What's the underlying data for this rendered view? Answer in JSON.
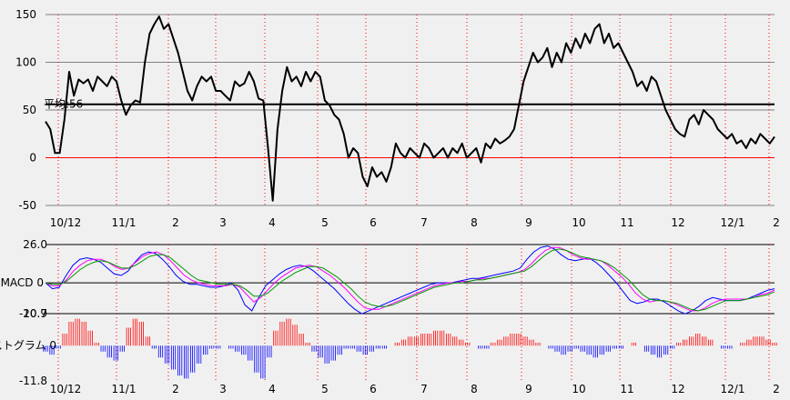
{
  "chart_data": [
    {
      "type": "line",
      "title": "",
      "x_tick_labels": [
        "10/12",
        "11/1",
        "2",
        "3",
        "4",
        "5",
        "6",
        "7",
        "8",
        "9",
        "10",
        "11",
        "12",
        "12/1",
        "2"
      ],
      "y_ticks": [
        "150",
        "100",
        "50",
        "0",
        "-50"
      ],
      "ylim": [
        -50,
        150
      ],
      "reference_lines": [
        {
          "label": "平均:56",
          "value": 56,
          "color": "#000000"
        },
        {
          "label": "",
          "value": 0,
          "color": "#ff0000"
        }
      ],
      "series": [
        {
          "values": [
            38,
            30,
            5,
            5,
            40,
            90,
            65,
            82,
            78,
            82,
            70,
            85,
            80,
            75,
            85,
            80,
            60,
            45,
            55,
            60,
            58,
            100,
            130,
            140,
            148,
            135,
            140,
            125,
            110,
            90,
            70,
            60,
            75,
            85,
            80,
            85,
            70,
            70,
            65,
            60,
            80,
            75,
            78,
            90,
            80,
            62,
            60,
            10,
            -45,
            30,
            70,
            95,
            80,
            85,
            75,
            90,
            80,
            90,
            85,
            60,
            55,
            45,
            40,
            25,
            0,
            10,
            5,
            -20,
            -30,
            -10,
            -20,
            -15,
            -25,
            -10,
            15,
            5,
            0,
            10,
            5,
            0,
            15,
            10,
            0,
            5,
            10,
            0,
            10,
            5,
            15,
            0,
            5,
            10,
            -5,
            15,
            10,
            20,
            15,
            18,
            22,
            30,
            55,
            80,
            95,
            110,
            100,
            105,
            115,
            95,
            110,
            100,
            120,
            110,
            125,
            115,
            130,
            120,
            135,
            140,
            120,
            130,
            115,
            120,
            110,
            100,
            90,
            75,
            80,
            70,
            85,
            80,
            65,
            50,
            40,
            30,
            25,
            22,
            40,
            45,
            35,
            50,
            45,
            40,
            30,
            25,
            20,
            25,
            15,
            18,
            10,
            20,
            15,
            25,
            20,
            15,
            22
          ]
        }
      ],
      "grid": true
    },
    {
      "type": "line",
      "title": "MACD",
      "y_ticks": [
        "26.0",
        "0",
        "-20.9"
      ],
      "ylim": [
        -20.9,
        26.0
      ],
      "series": [
        {
          "color": "#0000ff",
          "values": [
            0,
            -4,
            -3,
            5,
            12,
            16,
            17,
            16,
            14,
            10,
            6,
            5,
            8,
            14,
            19,
            21,
            20,
            16,
            11,
            5,
            1,
            -1,
            -1,
            -2,
            -3,
            -3,
            -2,
            0,
            -5,
            -15,
            -19,
            -10,
            -2,
            2,
            6,
            9,
            11,
            12,
            11,
            8,
            4,
            0,
            -4,
            -9,
            -14,
            -18,
            -21,
            -19,
            -17,
            -15,
            -13,
            -11,
            -9,
            -7,
            -5,
            -3,
            -1,
            0,
            0,
            0,
            1,
            2,
            3,
            3,
            4,
            5,
            6,
            7,
            8,
            10,
            16,
            21,
            24,
            25,
            23,
            19,
            16,
            15,
            16,
            17,
            14,
            10,
            5,
            0,
            -6,
            -12,
            -14,
            -13,
            -11,
            -11,
            -13,
            -16,
            -19,
            -21,
            -19,
            -16,
            -12,
            -10,
            -11,
            -12,
            -12,
            -12,
            -11,
            -9,
            -7,
            -5,
            -4
          ]
        },
        {
          "color": "#ff00ff",
          "values": [
            0,
            -2,
            -2,
            2,
            8,
            12,
            15,
            16,
            16,
            14,
            11,
            9,
            10,
            14,
            18,
            20,
            21,
            19,
            15,
            10,
            5,
            2,
            0,
            -1,
            -2,
            -2,
            -2,
            -1,
            -3,
            -8,
            -13,
            -10,
            -5,
            0,
            4,
            7,
            10,
            11,
            12,
            11,
            8,
            5,
            1,
            -3,
            -8,
            -13,
            -17,
            -18,
            -18,
            -16,
            -14,
            -12,
            -10,
            -8,
            -6,
            -4,
            -2,
            -1,
            0,
            0,
            1,
            1,
            2,
            3,
            3,
            4,
            5,
            6,
            7,
            9,
            13,
            18,
            22,
            24,
            24,
            22,
            19,
            17,
            16,
            16,
            15,
            12,
            8,
            4,
            -1,
            -7,
            -11,
            -13,
            -12,
            -12,
            -13,
            -15,
            -17,
            -19,
            -19,
            -17,
            -14,
            -12,
            -11,
            -11,
            -11,
            -11,
            -10,
            -8,
            -7,
            -5
          ]
        },
        {
          "color": "#009900",
          "values": [
            0,
            -1,
            -1,
            1,
            5,
            9,
            12,
            14,
            15,
            14,
            12,
            10,
            10,
            12,
            15,
            18,
            19,
            19,
            17,
            13,
            9,
            5,
            2,
            1,
            0,
            -1,
            -1,
            -1,
            -2,
            -5,
            -9,
            -9,
            -7,
            -3,
            1,
            4,
            7,
            9,
            11,
            11,
            10,
            7,
            4,
            0,
            -4,
            -9,
            -13,
            -15,
            -16,
            -16,
            -15,
            -13,
            -11,
            -9,
            -7,
            -5,
            -3,
            -2,
            -1,
            0,
            0,
            1,
            2,
            2,
            3,
            4,
            5,
            6,
            7,
            8,
            11,
            15,
            19,
            22,
            23,
            22,
            20,
            18,
            17,
            16,
            15,
            13,
            10,
            6,
            2,
            -3,
            -8,
            -11,
            -12,
            -12,
            -13,
            -14,
            -16,
            -18,
            -19,
            -18,
            -16,
            -14,
            -12,
            -12,
            -12,
            -11,
            -10,
            -9,
            -8,
            -6
          ]
        }
      ]
    },
    {
      "type": "bar",
      "title": "ヒストグラム",
      "x_tick_labels": [
        "10/12",
        "11/1",
        "2",
        "3",
        "4",
        "5",
        "6",
        "7",
        "8",
        "9",
        "10",
        "11",
        "12",
        "12/1",
        "2"
      ],
      "y_ticks": [
        "10.7",
        "0",
        "-11.8"
      ],
      "ylim": [
        -11.8,
        10.7
      ],
      "colors": {
        "positive": "#ff0000",
        "negative": "#0000ff"
      },
      "values": [
        -2,
        -3,
        -1,
        4,
        8,
        9,
        8,
        5,
        1,
        -2,
        -4,
        -5,
        -2,
        6,
        9,
        8,
        3,
        -1,
        -4,
        -6,
        -8,
        -10,
        -11,
        -9,
        -6,
        -3,
        -1,
        -1,
        0,
        -1,
        -2,
        -3,
        -5,
        -9,
        -11,
        -4,
        5,
        8,
        9,
        7,
        4,
        1,
        -2,
        -4,
        -6,
        -5,
        -3,
        -1,
        -1,
        -2,
        -3,
        -2,
        -1,
        -1,
        0,
        1,
        2,
        3,
        3,
        4,
        4,
        5,
        5,
        4,
        3,
        2,
        1,
        0,
        -1,
        -1,
        1,
        2,
        3,
        4,
        4,
        3,
        2,
        1,
        0,
        -1,
        -2,
        -3,
        -2,
        -1,
        -2,
        -3,
        -4,
        -3,
        -2,
        -1,
        -1,
        0,
        1,
        0,
        -2,
        -3,
        -4,
        -3,
        -1,
        1,
        2,
        3,
        4,
        3,
        2,
        0,
        -1,
        -1,
        0,
        1,
        2,
        3,
        3,
        2,
        1
      ]
    }
  ]
}
